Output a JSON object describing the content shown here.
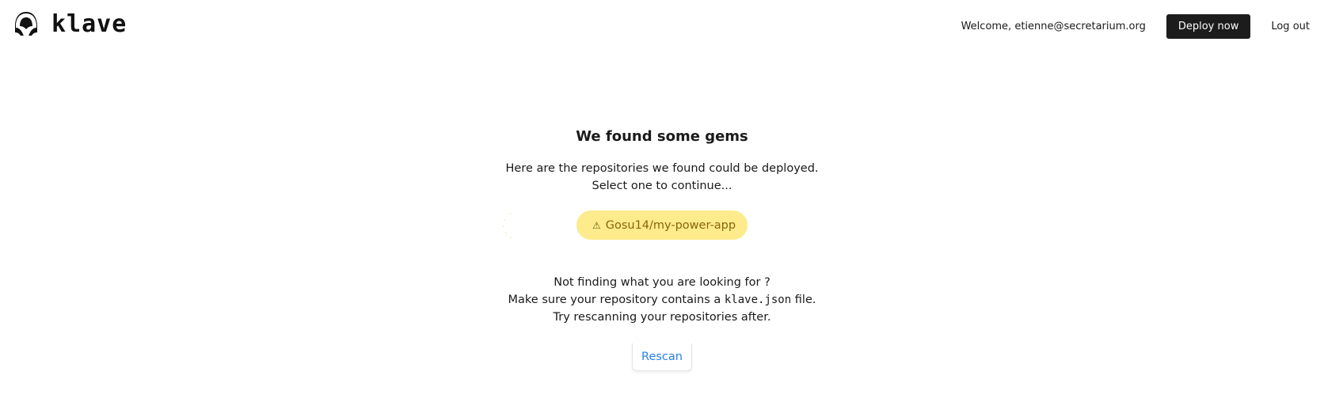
{
  "header": {
    "logo_text": "klave",
    "welcome": "Welcome, etienne@secretarium.org",
    "deploy_label": "Deploy now",
    "logout_label": "Log out"
  },
  "main": {
    "title": "We found some gems",
    "desc_line1": "Here are the repositories we found could be deployed.",
    "desc_line2": "Select one to continue...",
    "repositories": [
      {
        "icon": "warning-icon",
        "icon_glyph": "⚠",
        "name": "Gosu14/my-power-app",
        "status_color": "#fdeb8c"
      }
    ],
    "help_line1": "Not finding what you are looking for ?",
    "help_line2_before": "Make sure your repository contains a ",
    "help_line2_code": "klave.json",
    "help_line2_after": " file.",
    "help_line3": "Try rescanning your repositories after.",
    "rescan_label": "Rescan"
  },
  "colors": {
    "deploy_button": "#1c1c1c",
    "repo_pill": "#fdeb8c",
    "repo_text": "#8a6508",
    "link_blue": "#2680eb"
  }
}
